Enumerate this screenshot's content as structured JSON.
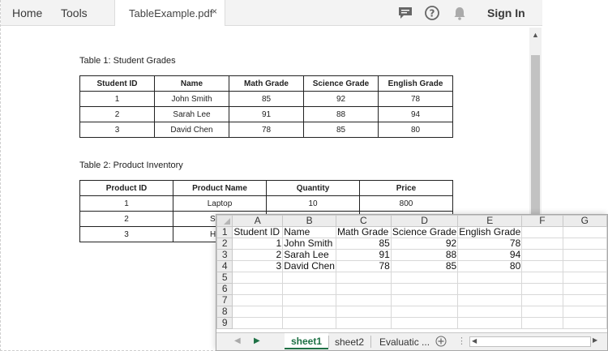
{
  "pdf_viewer": {
    "nav": {
      "home": "Home",
      "tools": "Tools"
    },
    "tab": {
      "title": "TableExample.pdf",
      "close": "×"
    },
    "toolbar": {
      "sign_in": "Sign In"
    },
    "icons": [
      "comment-icon",
      "help-icon",
      "bell-icon"
    ],
    "table1": {
      "caption": "Table 1: Student Grades",
      "headers": [
        "Student ID",
        "Name",
        "Math Grade",
        "Science Grade",
        "English Grade"
      ],
      "rows": [
        [
          "1",
          "John Smith",
          "85",
          "92",
          "78"
        ],
        [
          "2",
          "Sarah Lee",
          "91",
          "88",
          "94"
        ],
        [
          "3",
          "David Chen",
          "78",
          "85",
          "80"
        ]
      ]
    },
    "table2": {
      "caption": "Table 2: Product Inventory",
      "headers": [
        "Product ID",
        "Product Name",
        "Quantity",
        "Price"
      ],
      "rows": [
        [
          "1",
          "Laptop",
          "10",
          "800"
        ],
        [
          "2",
          "Smar",
          "",
          ""
        ],
        [
          "3",
          "Head",
          "",
          ""
        ]
      ]
    }
  },
  "spreadsheet": {
    "columns": [
      "A",
      "B",
      "C",
      "D",
      "E",
      "F",
      "G"
    ],
    "row_numbers": [
      "1",
      "2",
      "3",
      "4",
      "5",
      "6",
      "7",
      "8",
      "9"
    ],
    "cells": [
      [
        "Student ID",
        "Name",
        "Math Grade",
        "Science Grade",
        "English Grade",
        "",
        ""
      ],
      [
        "1",
        "John Smith",
        "85",
        "92",
        "78",
        "",
        ""
      ],
      [
        "2",
        "Sarah Lee",
        "91",
        "88",
        "94",
        "",
        ""
      ],
      [
        "3",
        "David Chen",
        "78",
        "85",
        "80",
        "",
        ""
      ],
      [
        "",
        "",
        "",
        "",
        "",
        "",
        ""
      ],
      [
        "",
        "",
        "",
        "",
        "",
        "",
        ""
      ],
      [
        "",
        "",
        "",
        "",
        "",
        "",
        ""
      ],
      [
        "",
        "",
        "",
        "",
        "",
        "",
        ""
      ],
      [
        "",
        "",
        "",
        "",
        "",
        "",
        ""
      ]
    ],
    "sheet_tabs": [
      "sheet1",
      "sheet2",
      "Evaluatic ..."
    ],
    "active_tab": "sheet1",
    "accent_color": "#1e7145"
  }
}
